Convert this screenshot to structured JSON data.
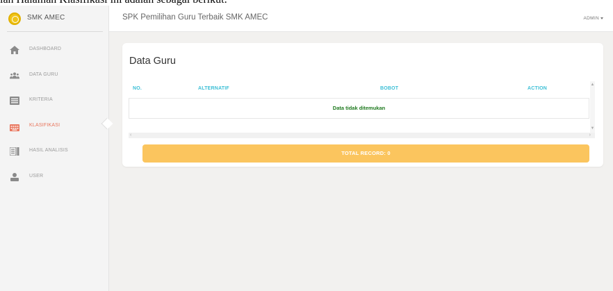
{
  "page_top_text": "lah Halaman Klasifikasi ini adalah sebagai berikut:",
  "brand": {
    "name": "SMK AMEC"
  },
  "header": {
    "title": "SPK Pemilihan Guru Terbaik SMK AMEC",
    "user": "ADMIN"
  },
  "sidebar": {
    "items": [
      {
        "label": "DASHBOARD",
        "icon": "home-icon"
      },
      {
        "label": "DATA GURU",
        "icon": "users-icon"
      },
      {
        "label": "KRITERIA",
        "icon": "list-icon"
      },
      {
        "label": "KLASIFIKASI",
        "icon": "keyboard-icon",
        "active": true
      },
      {
        "label": "HASIL ANALISIS",
        "icon": "report-icon"
      },
      {
        "label": "USER",
        "icon": "user-icon"
      }
    ]
  },
  "card": {
    "title": "Data Guru",
    "columns": [
      "NO.",
      "ALTERNATIF",
      "BOBOT",
      "ACTION"
    ],
    "empty_message": "Data tidak ditemukan",
    "total_label": "TOTAL RECORD: 0"
  },
  "colors": {
    "accent_cyan": "#3cbfd6",
    "active_orange": "#e8745b",
    "total_bar": "#fbc55e",
    "empty_text_green": "#1f7a1f"
  }
}
